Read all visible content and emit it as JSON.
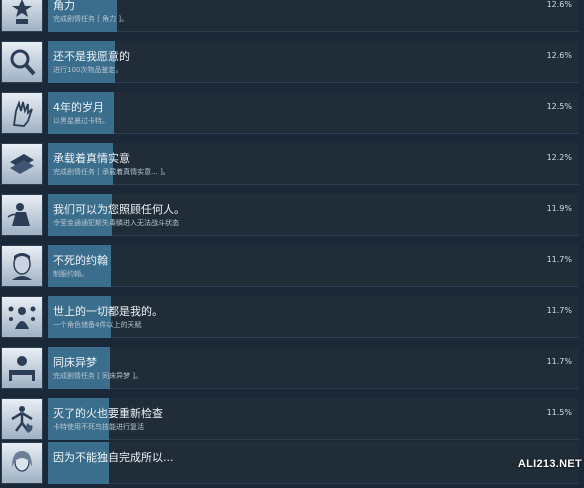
{
  "achievements": [
    {
      "title": "角力",
      "desc": "完成剧情任务 [ 角力 ]。",
      "percent": "12.6%",
      "ratio": 0.126,
      "icon": "star-stand-icon"
    },
    {
      "title": "还不是我愿意的",
      "desc": "进行100次物品鉴定。",
      "percent": "12.6%",
      "ratio": 0.126,
      "icon": "magnifier-icon"
    },
    {
      "title": "4年的岁月",
      "desc": "以黑星晨过卡特。",
      "percent": "12.5%",
      "ratio": 0.125,
      "icon": "hand-icon"
    },
    {
      "title": "承载着真情实意",
      "desc": "完成剧情任务 [ 承载着真情实意... ]。",
      "percent": "12.2%",
      "ratio": 0.122,
      "icon": "letters-icon"
    },
    {
      "title": "我们可以为您照顾任何人。",
      "desc": "令莹金通通犯斯失毒鳞进入无法战斗状态",
      "percent": "11.9%",
      "ratio": 0.119,
      "icon": "lady-icon"
    },
    {
      "title": "不死的约翰",
      "desc": "制服约翰。",
      "percent": "11.7%",
      "ratio": 0.117,
      "icon": "portrait-icon"
    },
    {
      "title": "世上的一切都是我的。",
      "desc": "一个角色储备4件以上的天赋",
      "percent": "11.7%",
      "ratio": 0.117,
      "icon": "figure-orbs-icon"
    },
    {
      "title": "同床异梦",
      "desc": "完成剧情任务 [ 同床异梦 ]。",
      "percent": "11.7%",
      "ratio": 0.117,
      "icon": "bed-moon-icon"
    },
    {
      "title": "灭了的火也要重新检查",
      "desc": "卡特使用不死鸟技能进行复活",
      "percent": "11.5%",
      "ratio": 0.115,
      "icon": "flame-figure-icon"
    },
    {
      "title": "因为不能独自完成所以...",
      "desc": "",
      "percent": "",
      "ratio": 0.115,
      "icon": "portrait-girl-icon"
    }
  ],
  "watermark": "ALI213.NET"
}
